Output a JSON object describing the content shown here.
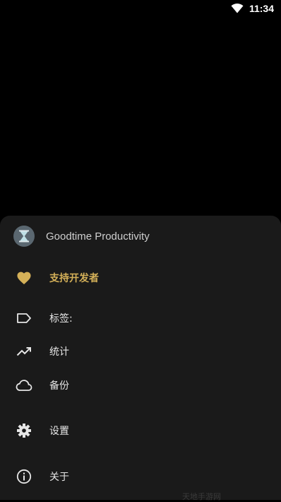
{
  "status_bar": {
    "time": "11:34",
    "wifi_icon": "wifi-icon"
  },
  "drawer": {
    "app_logo_icon": "hourglass-icon",
    "app_title": "Goodtime Productivity",
    "items": [
      {
        "label": "支持开发者",
        "icon": "heart-icon",
        "highlight_color": "#d4b058"
      },
      {
        "label": "标签:",
        "icon": "label-icon"
      },
      {
        "label": "统计",
        "icon": "trending-up-icon"
      },
      {
        "label": "备份",
        "icon": "cloud-icon"
      },
      {
        "label": "设置",
        "icon": "gear-icon"
      },
      {
        "label": "关于",
        "icon": "info-icon"
      }
    ]
  },
  "watermark": "天地手游网",
  "colors": {
    "background": "#000000",
    "sheet": "#1a1a1a",
    "accent": "#d4b058",
    "text": "#e6e6e6"
  }
}
